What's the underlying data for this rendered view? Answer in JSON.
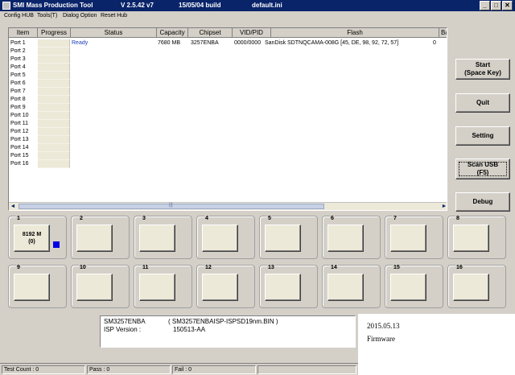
{
  "window": {
    "title": "SMI Mass Production Tool",
    "version": "V 2.5.42   v7",
    "build": "15/05/04 build",
    "ini_file": "default.ini",
    "minimize_glyph": "_",
    "maximize_glyph": "□",
    "close_glyph": "✕"
  },
  "menu": [
    "Config HUB",
    "Tools(T)",
    "Dialog Option",
    "Reset Hub"
  ],
  "grid": {
    "columns": [
      "Item",
      "Progress",
      "Status",
      "Capacity",
      "Chipset",
      "VID/PID",
      "Flash",
      "Bac"
    ],
    "rows": [
      {
        "port": "Port 1",
        "status": "Ready",
        "capacity": "7680 MB",
        "chipset": "3257ENBA",
        "vidpid": "0000/0000",
        "flash": "SanDisk SDTNQCAMA-008G [45, DE, 98, 92, 72, 57]",
        "bad": "0"
      },
      {
        "port": "Port 2",
        "status": "",
        "capacity": "",
        "chipset": "",
        "vidpid": "",
        "flash": "",
        "bad": ""
      },
      {
        "port": "Port 3",
        "status": "",
        "capacity": "",
        "chipset": "",
        "vidpid": "",
        "flash": "",
        "bad": ""
      },
      {
        "port": "Port 4",
        "status": "",
        "capacity": "",
        "chipset": "",
        "vidpid": "",
        "flash": "",
        "bad": ""
      },
      {
        "port": "Port 5",
        "status": "",
        "capacity": "",
        "chipset": "",
        "vidpid": "",
        "flash": "",
        "bad": ""
      },
      {
        "port": "Port 6",
        "status": "",
        "capacity": "",
        "chipset": "",
        "vidpid": "",
        "flash": "",
        "bad": ""
      },
      {
        "port": "Port 7",
        "status": "",
        "capacity": "",
        "chipset": "",
        "vidpid": "",
        "flash": "",
        "bad": ""
      },
      {
        "port": "Port 8",
        "status": "",
        "capacity": "",
        "chipset": "",
        "vidpid": "",
        "flash": "",
        "bad": ""
      },
      {
        "port": "Port 9",
        "status": "",
        "capacity": "",
        "chipset": "",
        "vidpid": "",
        "flash": "",
        "bad": ""
      },
      {
        "port": "Port 10",
        "status": "",
        "capacity": "",
        "chipset": "",
        "vidpid": "",
        "flash": "",
        "bad": ""
      },
      {
        "port": "Port 11",
        "status": "",
        "capacity": "",
        "chipset": "",
        "vidpid": "",
        "flash": "",
        "bad": ""
      },
      {
        "port": "Port 12",
        "status": "",
        "capacity": "",
        "chipset": "",
        "vidpid": "",
        "flash": "",
        "bad": ""
      },
      {
        "port": "Port 13",
        "status": "",
        "capacity": "",
        "chipset": "",
        "vidpid": "",
        "flash": "",
        "bad": ""
      },
      {
        "port": "Port 14",
        "status": "",
        "capacity": "",
        "chipset": "",
        "vidpid": "",
        "flash": "",
        "bad": ""
      },
      {
        "port": "Port 15",
        "status": "",
        "capacity": "",
        "chipset": "",
        "vidpid": "",
        "flash": "",
        "bad": ""
      },
      {
        "port": "Port 16",
        "status": "",
        "capacity": "",
        "chipset": "",
        "vidpid": "",
        "flash": "",
        "bad": ""
      }
    ],
    "scroll_left": "◄",
    "scroll_right": "►",
    "thumb_grip": "|||"
  },
  "buttons": {
    "start": "Start\n(Space Key)",
    "quit": "Quit",
    "setting": "Setting",
    "scan_usb": "Scan USB\n(F5)",
    "debug": "Debug"
  },
  "ports": [
    {
      "num": "1",
      "label": "8192 M\n(0)",
      "active": true
    },
    {
      "num": "2",
      "label": ""
    },
    {
      "num": "3",
      "label": ""
    },
    {
      "num": "4",
      "label": ""
    },
    {
      "num": "5",
      "label": ""
    },
    {
      "num": "6",
      "label": ""
    },
    {
      "num": "7",
      "label": ""
    },
    {
      "num": "8",
      "label": ""
    },
    {
      "num": "9",
      "label": ""
    },
    {
      "num": "10",
      "label": ""
    },
    {
      "num": "11",
      "label": ""
    },
    {
      "num": "12",
      "label": ""
    },
    {
      "num": "13",
      "label": ""
    },
    {
      "num": "14",
      "label": ""
    },
    {
      "num": "15",
      "label": ""
    },
    {
      "num": "16",
      "label": ""
    }
  ],
  "info": {
    "chip": "SM3257ENBA",
    "isp_file": "( SM3257ENBAISP-ISPSD19nm.BIN )",
    "isp_label": "ISP Version :",
    "isp_version": "150513-AA"
  },
  "overlay": {
    "date": "2015.05.13",
    "label": "Firmware"
  },
  "status": {
    "test_count": "Test Count : 0",
    "pass": "Pass : 0",
    "fail": "Fail : 0"
  },
  "colors": {
    "titlebar": "#0a246a",
    "face": "#d4d0c8",
    "progress_cell": "#ece9d8",
    "active_port_indicator": "#0000e0",
    "ready_text": "#1e3cb4"
  }
}
